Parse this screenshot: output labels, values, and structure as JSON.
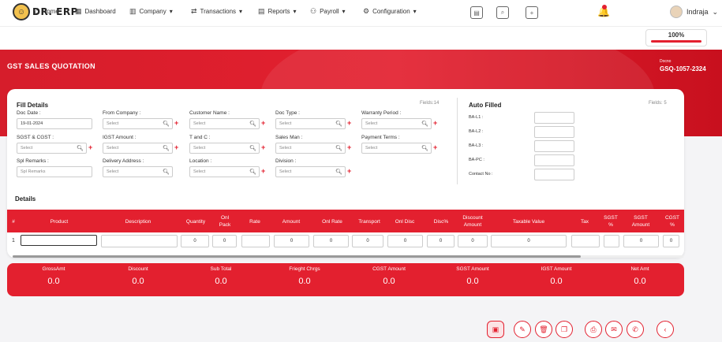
{
  "app": {
    "logo_text": "DR. ERP",
    "user_name": "Indraja"
  },
  "icons": {
    "logo": "smiley-logo-icon",
    "doc1": "document-icon",
    "doc2": "document-search-icon",
    "doc3": "document-plus-icon",
    "bell": "bell-icon",
    "avatar": "avatar-icon"
  },
  "nav": {
    "home": "Home",
    "dashboard": "Dashboard",
    "company": "Company",
    "transactions": "Transactions",
    "reports": "Reports",
    "payroll": "Payroll",
    "configuration": "Configuration"
  },
  "progress": {
    "label": "100%",
    "value": 1.0
  },
  "banner": {
    "title": "GST SALES QUOTATION",
    "docno_label": "Docno",
    "docno": "GSQ-1057-2324"
  },
  "fill": {
    "title": "Fill Details",
    "fields_count": "Fields:14",
    "doc_date_label": "Doc Date :",
    "doc_date": "19-01-2024",
    "from_company_label": "From Company :",
    "from_company_ph": "Select",
    "customer_name_label": "Customer Name :",
    "customer_name_ph": "Select",
    "doc_type_label": "Doc Type :",
    "doc_type_ph": "Select",
    "warranty_label": "Warranty Period :",
    "warranty_ph": "Select",
    "sgst_cgst_label": "SGST & CGST :",
    "sgst_cgst_ph": "Select",
    "igst_label": "IGST Amount :",
    "igst_ph": "Select",
    "tandc_label": "T and C :",
    "tandc_ph": "Select",
    "salesman_label": "Sales Man :",
    "salesman_ph": "Select",
    "payment_label": "Payment Terms :",
    "payment_ph": "Select",
    "spl_label": "Spl Remarks :",
    "spl_ph": "Spl Remarks",
    "delivery_label": "Delivery Address :",
    "delivery_ph": "Select",
    "location_label": "Location :",
    "location_ph": "Select",
    "division_label": "Division :",
    "division_ph": "Select"
  },
  "auto": {
    "title": "Auto Filled",
    "fields_count": "Fields: 5",
    "ba_l1": "BA-L1 :",
    "ba_l2": "BA-L2 :",
    "ba_l3": "BA-L3 :",
    "ba_pc": "BA-PC :",
    "contact": "Contact No :"
  },
  "details": {
    "title": "Details",
    "headers": [
      "#",
      "Product",
      "Description",
      "Quantity",
      "Onl Pack",
      "Rate",
      "Amount",
      "Onl Rate",
      "Transport",
      "Onl Disc",
      "Disc%",
      "Discount Amount",
      "Taxable Value",
      "Tax",
      "SGST %",
      "SGST Amount",
      "CGST %"
    ],
    "row": {
      "num": "1",
      "quantity": "0",
      "onl_pack": "0",
      "amount": "0",
      "onl_rate": "0",
      "transport": "0",
      "onl_disc": "0",
      "disc_pct": "0",
      "discount_amount": "0",
      "taxable_value": "0",
      "sgst_amount": "0",
      "cgst_pct": "0"
    }
  },
  "totals": [
    {
      "label": "GrossAmt",
      "value": "0.0"
    },
    {
      "label": "Discount",
      "value": "0.0"
    },
    {
      "label": "Sub Total",
      "value": "0.0"
    },
    {
      "label": "Frieght Chrgs",
      "value": "0.0"
    },
    {
      "label": "CGST Amount",
      "value": "0.0"
    },
    {
      "label": "SGST Amount",
      "value": "0.0"
    },
    {
      "label": "IGST Amount",
      "value": "0.0"
    },
    {
      "label": "Net Amt",
      "value": "0.0"
    }
  ],
  "actions": [
    "save-icon",
    "edit-icon",
    "delete-icon",
    "copy-icon",
    "print-icon",
    "email-icon",
    "whatsapp-icon",
    "back-icon"
  ],
  "colors": {
    "accent": "#e3202f"
  }
}
